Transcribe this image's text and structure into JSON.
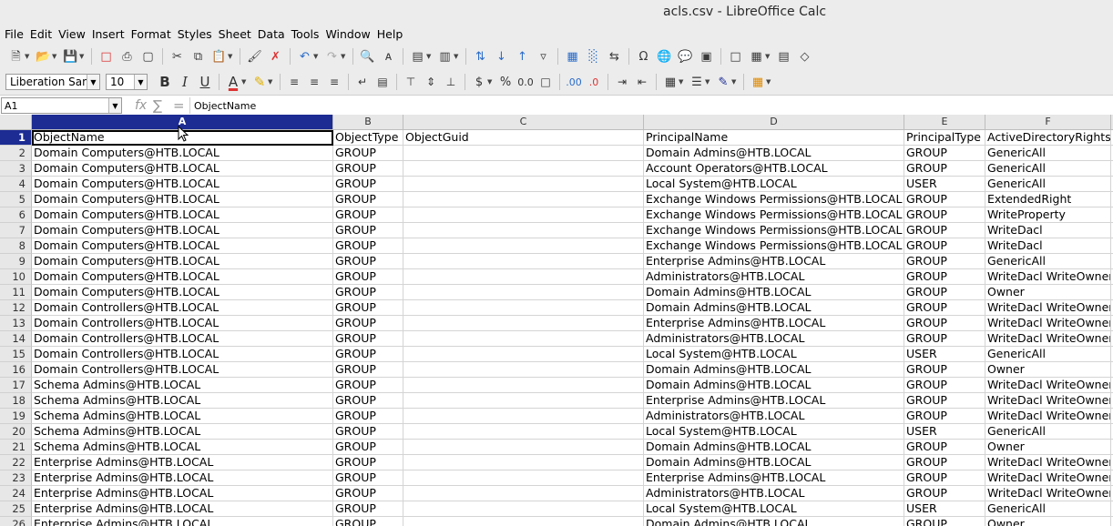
{
  "window": {
    "title": "acls.csv - LibreOffice Calc"
  },
  "menu": [
    "File",
    "Edit",
    "View",
    "Insert",
    "Format",
    "Styles",
    "Sheet",
    "Data",
    "Tools",
    "Window",
    "Help"
  ],
  "format_bar": {
    "font_name": "Liberation Sans",
    "font_size": "10"
  },
  "formula_bar": {
    "cell_ref": "A1",
    "content": "ObjectName"
  },
  "columns": [
    "A",
    "B",
    "C",
    "D",
    "E",
    "F"
  ],
  "selected": {
    "column": "A",
    "row": "1"
  },
  "rows": [
    {
      "n": "1",
      "cells": [
        "ObjectName",
        "ObjectType",
        "ObjectGuid",
        "PrincipalName",
        "PrincipalType",
        "ActiveDirectoryRights"
      ]
    },
    {
      "n": "2",
      "cells": [
        "Domain Computers@HTB.LOCAL",
        "GROUP",
        "",
        "Domain Admins@HTB.LOCAL",
        "GROUP",
        "GenericAll"
      ]
    },
    {
      "n": "3",
      "cells": [
        "Domain Computers@HTB.LOCAL",
        "GROUP",
        "",
        "Account Operators@HTB.LOCAL",
        "GROUP",
        "GenericAll"
      ]
    },
    {
      "n": "4",
      "cells": [
        "Domain Computers@HTB.LOCAL",
        "GROUP",
        "",
        "Local System@HTB.LOCAL",
        "USER",
        "GenericAll"
      ]
    },
    {
      "n": "5",
      "cells": [
        "Domain Computers@HTB.LOCAL",
        "GROUP",
        "",
        "Exchange Windows Permissions@HTB.LOCAL",
        "GROUP",
        "ExtendedRight"
      ]
    },
    {
      "n": "6",
      "cells": [
        "Domain Computers@HTB.LOCAL",
        "GROUP",
        "",
        "Exchange Windows Permissions@HTB.LOCAL",
        "GROUP",
        "WriteProperty"
      ]
    },
    {
      "n": "7",
      "cells": [
        "Domain Computers@HTB.LOCAL",
        "GROUP",
        "",
        "Exchange Windows Permissions@HTB.LOCAL",
        "GROUP",
        "WriteDacl"
      ]
    },
    {
      "n": "8",
      "cells": [
        "Domain Computers@HTB.LOCAL",
        "GROUP",
        "",
        "Exchange Windows Permissions@HTB.LOCAL",
        "GROUP",
        "WriteDacl"
      ]
    },
    {
      "n": "9",
      "cells": [
        "Domain Computers@HTB.LOCAL",
        "GROUP",
        "",
        "Enterprise Admins@HTB.LOCAL",
        "GROUP",
        "GenericAll"
      ]
    },
    {
      "n": "10",
      "cells": [
        "Domain Computers@HTB.LOCAL",
        "GROUP",
        "",
        "Administrators@HTB.LOCAL",
        "GROUP",
        "WriteDacl WriteOwner"
      ]
    },
    {
      "n": "11",
      "cells": [
        "Domain Computers@HTB.LOCAL",
        "GROUP",
        "",
        "Domain Admins@HTB.LOCAL",
        "GROUP",
        "Owner"
      ]
    },
    {
      "n": "12",
      "cells": [
        "Domain Controllers@HTB.LOCAL",
        "GROUP",
        "",
        "Domain Admins@HTB.LOCAL",
        "GROUP",
        "WriteDacl WriteOwner"
      ]
    },
    {
      "n": "13",
      "cells": [
        "Domain Controllers@HTB.LOCAL",
        "GROUP",
        "",
        "Enterprise Admins@HTB.LOCAL",
        "GROUP",
        "WriteDacl WriteOwner"
      ]
    },
    {
      "n": "14",
      "cells": [
        "Domain Controllers@HTB.LOCAL",
        "GROUP",
        "",
        "Administrators@HTB.LOCAL",
        "GROUP",
        "WriteDacl WriteOwner"
      ]
    },
    {
      "n": "15",
      "cells": [
        "Domain Controllers@HTB.LOCAL",
        "GROUP",
        "",
        "Local System@HTB.LOCAL",
        "USER",
        "GenericAll"
      ]
    },
    {
      "n": "16",
      "cells": [
        "Domain Controllers@HTB.LOCAL",
        "GROUP",
        "",
        "Domain Admins@HTB.LOCAL",
        "GROUP",
        "Owner"
      ]
    },
    {
      "n": "17",
      "cells": [
        "Schema Admins@HTB.LOCAL",
        "GROUP",
        "",
        "Domain Admins@HTB.LOCAL",
        "GROUP",
        "WriteDacl WriteOwner"
      ]
    },
    {
      "n": "18",
      "cells": [
        "Schema Admins@HTB.LOCAL",
        "GROUP",
        "",
        "Enterprise Admins@HTB.LOCAL",
        "GROUP",
        "WriteDacl WriteOwner"
      ]
    },
    {
      "n": "19",
      "cells": [
        "Schema Admins@HTB.LOCAL",
        "GROUP",
        "",
        "Administrators@HTB.LOCAL",
        "GROUP",
        "WriteDacl WriteOwner"
      ]
    },
    {
      "n": "20",
      "cells": [
        "Schema Admins@HTB.LOCAL",
        "GROUP",
        "",
        "Local System@HTB.LOCAL",
        "USER",
        "GenericAll"
      ]
    },
    {
      "n": "21",
      "cells": [
        "Schema Admins@HTB.LOCAL",
        "GROUP",
        "",
        "Domain Admins@HTB.LOCAL",
        "GROUP",
        "Owner"
      ]
    },
    {
      "n": "22",
      "cells": [
        "Enterprise Admins@HTB.LOCAL",
        "GROUP",
        "",
        "Domain Admins@HTB.LOCAL",
        "GROUP",
        "WriteDacl WriteOwner"
      ]
    },
    {
      "n": "23",
      "cells": [
        "Enterprise Admins@HTB.LOCAL",
        "GROUP",
        "",
        "Enterprise Admins@HTB.LOCAL",
        "GROUP",
        "WriteDacl WriteOwner"
      ]
    },
    {
      "n": "24",
      "cells": [
        "Enterprise Admins@HTB.LOCAL",
        "GROUP",
        "",
        "Administrators@HTB.LOCAL",
        "GROUP",
        "WriteDacl WriteOwner"
      ]
    },
    {
      "n": "25",
      "cells": [
        "Enterprise Admins@HTB.LOCAL",
        "GROUP",
        "",
        "Local System@HTB.LOCAL",
        "USER",
        "GenericAll"
      ]
    },
    {
      "n": "26",
      "cells": [
        "Enterprise Admins@HTB.LOCAL",
        "GROUP",
        "",
        "Domain Admins@HTB.LOCAL",
        "GROUP",
        "Owner"
      ]
    }
  ],
  "colors": {
    "selection": "#1c2c93",
    "header_bg": "#e7e7e7"
  }
}
